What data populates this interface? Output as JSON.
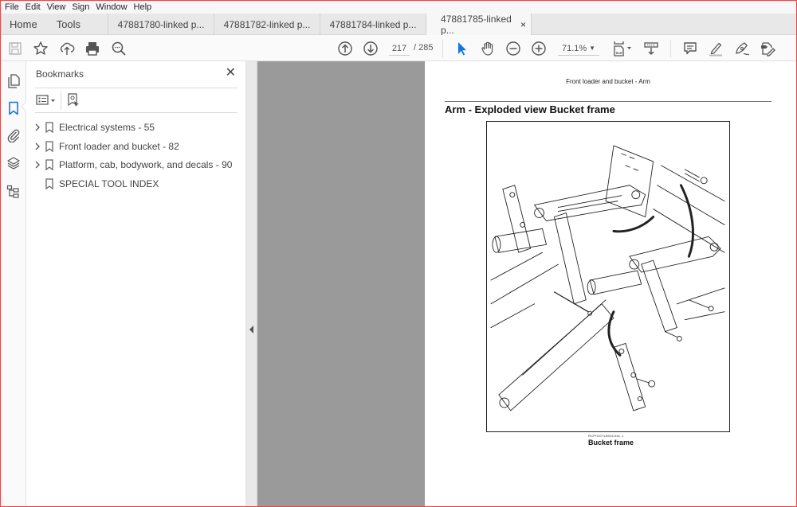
{
  "menu": [
    "File",
    "Edit",
    "View",
    "Sign",
    "Window",
    "Help"
  ],
  "tabs": {
    "home": "Home",
    "tools": "Tools",
    "documents": [
      {
        "label": "47881780-linked p...",
        "active": false
      },
      {
        "label": "47881782-linked p...",
        "active": false
      },
      {
        "label": "47881784-linked p...",
        "active": false
      },
      {
        "label": "47881785-linked p...",
        "active": true
      }
    ],
    "close_glyph": "×"
  },
  "toolbar": {
    "icons_left": [
      "save-icon",
      "bookmark-star-icon",
      "upload-cloud-icon",
      "print-icon",
      "find-icon"
    ],
    "current_page": "217",
    "page_total": "/ 285",
    "zoom_value": "71.1%",
    "zoom_caret": "▼",
    "icons_right": [
      "select-arrow-icon",
      "hand-icon",
      "zoom-out-icon",
      "zoom-in-icon",
      "fit-page-icon",
      "scroll-mode-icon",
      "comment-icon",
      "highlight-icon",
      "sign-icon",
      "fill-sign-icon"
    ]
  },
  "accent_color": "#1473e6",
  "left_rail": [
    "page-thumbnails-icon",
    "bookmarks-icon",
    "attachments-icon",
    "layers-icon",
    "structure-icon"
  ],
  "bookmarks_panel": {
    "title": "Bookmarks",
    "close_glyph": "✕",
    "items": [
      {
        "label": "Electrical systems - 55",
        "expandable": true
      },
      {
        "label": "Front loader and bucket - 82",
        "expandable": true
      },
      {
        "label": "Platform, cab, bodywork, and decals - 90",
        "expandable": true
      },
      {
        "label": "SPECIAL TOOL INDEX",
        "expandable": false
      }
    ]
  },
  "document_page": {
    "running_header": "Front loader and bucket - Arm",
    "heading": "Arm - Exploded view Bucket frame",
    "figure_code": "RCPH10TLB041GAL    1",
    "figure_caption": "Bucket frame"
  }
}
